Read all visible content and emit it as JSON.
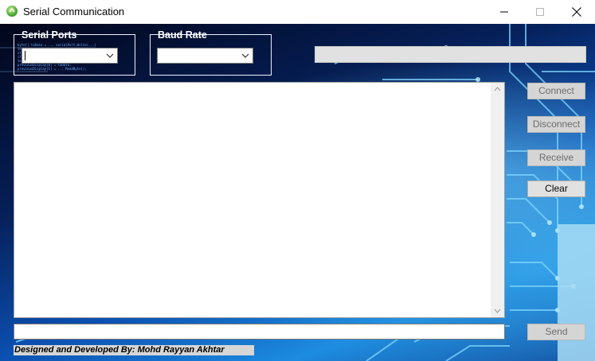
{
  "window": {
    "title": "Serial Communication",
    "icon": "app-icon",
    "controls": [
      "minimize-icon",
      "maximize-icon",
      "close-icon"
    ]
  },
  "serial_ports": {
    "label": "Serial Ports",
    "value": "",
    "code_lines": [
      "byte[] txData = ... serialPort.Write(...)",
      "int i;",
      "string status = ... port.IsOpen ? ...",
      "if (...) { ... }",
      "",
      "text.AppendText(...); ... DataReceived += new ...",
      "previousDisplay[0] = txData;",
      "previousDisplay[1] = ... ReadByte();"
    ]
  },
  "baud_rate": {
    "label": "Baud Rate",
    "value": ""
  },
  "status_field": {
    "value": ""
  },
  "output": {
    "text": ""
  },
  "buttons": {
    "connect": "Connect",
    "disconnect": "Disconnect",
    "receive": "Receive",
    "clear": "Clear",
    "send": "Send"
  },
  "send_input": {
    "value": ""
  },
  "credit": {
    "text": "Designed and Developed By: Mohd Rayyan Akhtar"
  },
  "colors": {
    "background_dark": "#02061a",
    "background_blue": "#0b4fb0",
    "circuit_glow": "#7fd6ff",
    "button_disabled_text": "#6d6d6d",
    "button_bg": "#d5d5d5",
    "credit_bg": "#d6d6d6"
  }
}
